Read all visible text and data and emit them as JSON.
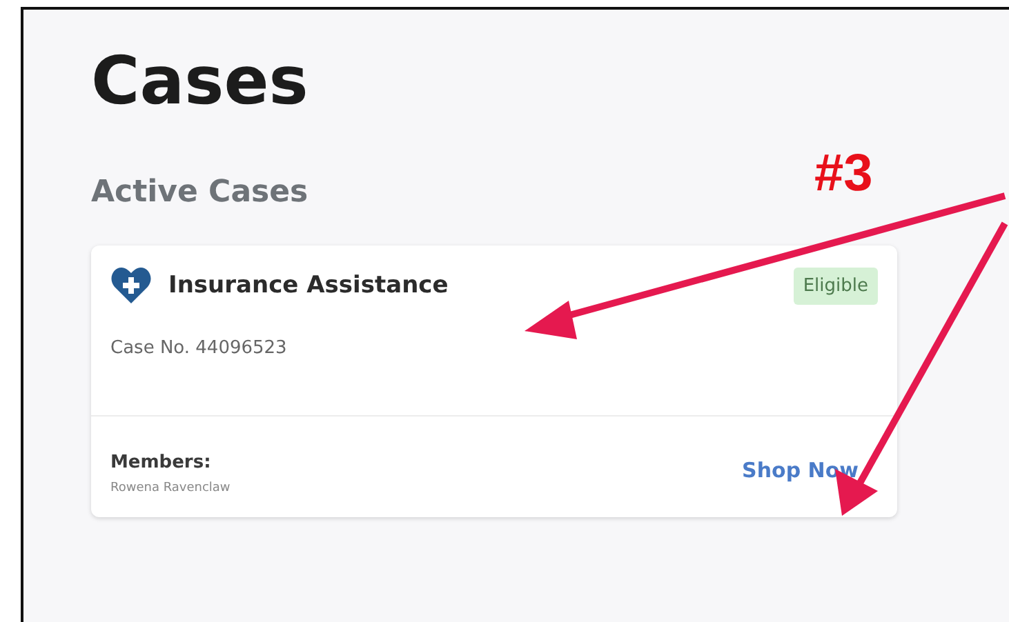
{
  "page": {
    "title": "Cases"
  },
  "section": {
    "title": "Active Cases"
  },
  "cases": [
    {
      "name": "Insurance Assistance",
      "status": "Eligible",
      "case_number": "Case No. 44096523",
      "members_label": "Members:",
      "members": "Rowena Ravenclaw",
      "action": "Shop Now"
    }
  ],
  "annotation": {
    "label": "#3"
  }
}
